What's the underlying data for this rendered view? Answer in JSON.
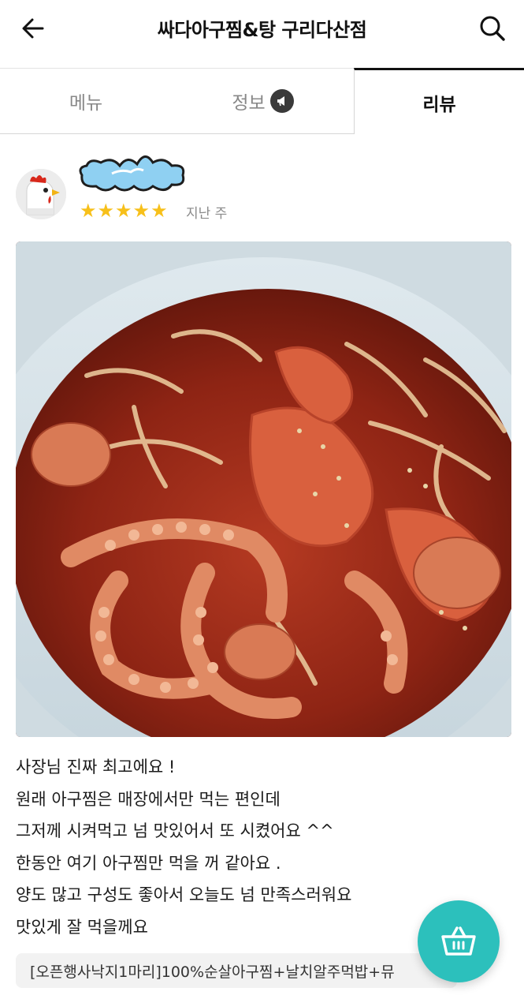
{
  "header": {
    "title": "싸다아구찜&탕 구리다산점",
    "back_icon": "arrow-left-icon",
    "search_icon": "search-icon"
  },
  "tabs": [
    {
      "label": "메뉴",
      "active": false
    },
    {
      "label": "정보",
      "active": false,
      "badge_icon": "megaphone-icon"
    },
    {
      "label": "리뷰",
      "active": true
    }
  ],
  "review": {
    "rating": 5,
    "date": "지난 주",
    "text_lines": [
      "사장님 진짜 최고에요 !",
      "원래 아구찜은 매장에서만 먹는 편인데",
      "그저께 시켜먹고 넘 맛있어서 또 시켰어요 ^^",
      "한동안 여기 아구찜만 먹을 꺼 같아요 .",
      "양도 많고 구성도 좋아서 오늘도 넘 만족스러워요",
      "맛있게 잘 먹을께요"
    ],
    "ordered_menu": "[오픈행사낙지1마리]100%순살아구찜+날치알주먹밥+뮤"
  },
  "cart": {
    "icon": "basket-icon"
  },
  "colors": {
    "accent": "#2cc0bc",
    "star": "#f7c01a",
    "tab_active": "#111111",
    "tab_inactive": "#888888"
  }
}
